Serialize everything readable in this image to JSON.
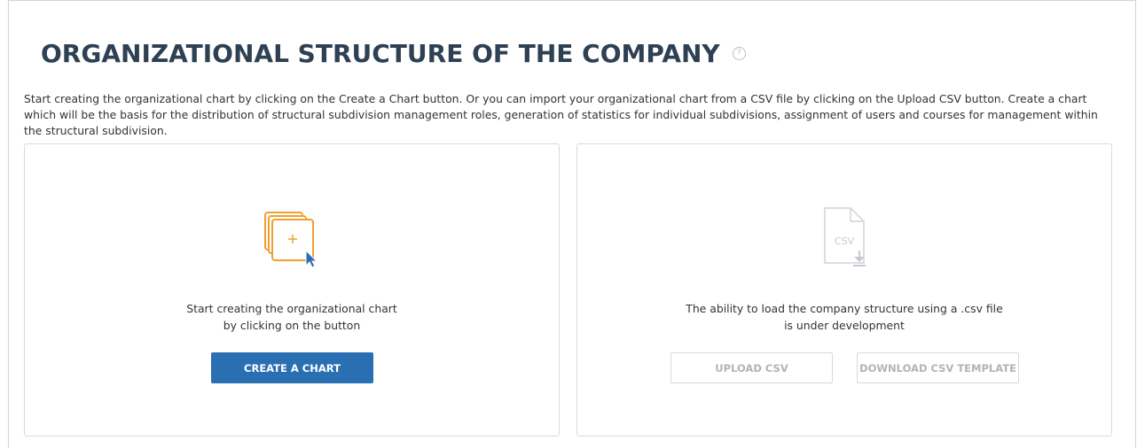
{
  "page": {
    "title": "ORGANIZATIONAL STRUCTURE OF THE COMPANY",
    "help_icon": "question-circle-icon",
    "description": "Start creating the organizational chart by clicking on the Create a Chart button. Or you can import your organizational chart from a CSV file by clicking on the Upload CSV button. Create a chart which will be the basis for the distribution of structural subdivision management roles, generation of statistics for individual subdivisions, assignment of users and courses for management within the structural subdivision."
  },
  "create_card": {
    "icon": "create-chart-icon",
    "text_line1": "Start creating the organizational chart",
    "text_line2": "by clicking on the button",
    "button_label": "CREATE A CHART"
  },
  "csv_card": {
    "icon": "csv-file-download-icon",
    "icon_text": "CSV",
    "text_line1": "The ability to load the company structure using a .csv file",
    "text_line2": "is under development",
    "upload_label": "UPLOAD CSV",
    "download_label": "DOWNLOAD CSV TEMPLATE"
  },
  "colors": {
    "title": "#2e4053",
    "primary": "#2a6fb2",
    "accent_orange": "#f0a030",
    "disabled": "#b3b3b3"
  }
}
